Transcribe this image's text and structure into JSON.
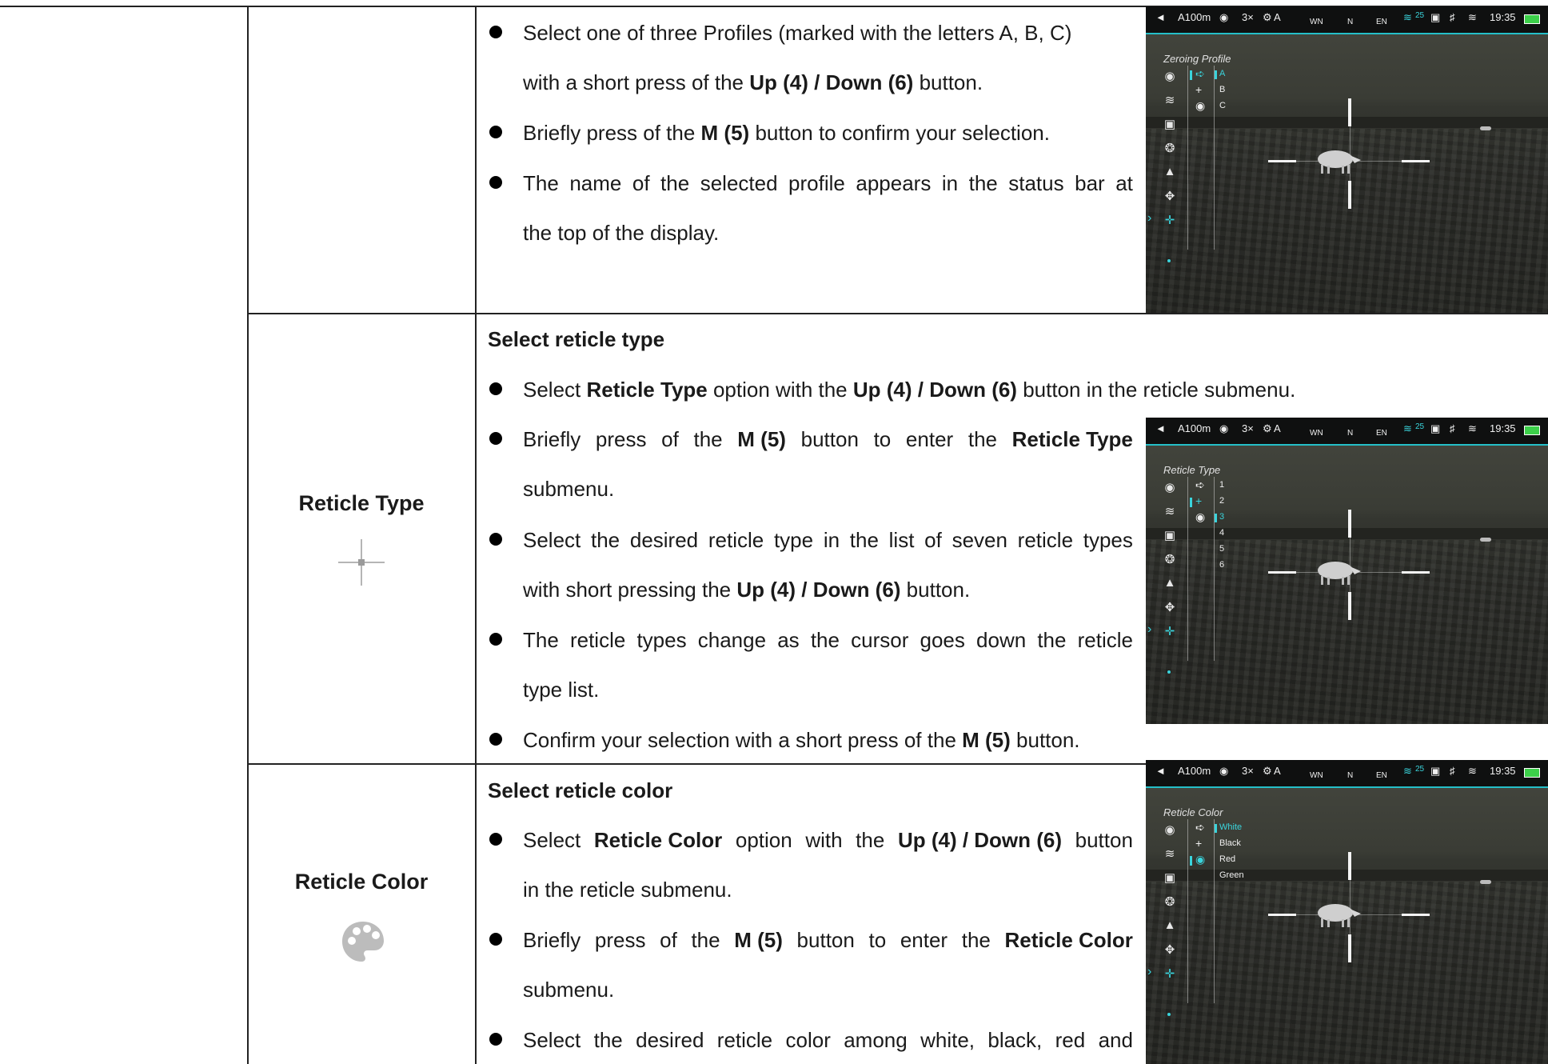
{
  "rows": {
    "zeroing": {
      "bullets": [
        {
          "line1": [
            "Select one of three Profiles (marked with the letters A, B, C)"
          ],
          "line2": "with a short press of the ",
          "line2_b": "Up (4) / Down (6)",
          "line2_end": " button."
        },
        {
          "pre": "Briefly press of the ",
          "b": "M (5)",
          "post": " button to confirm your selection."
        },
        {
          "line1_words": [
            "The",
            "name",
            "of",
            "the",
            "selected",
            "profile",
            "appears",
            "in",
            "the",
            "status",
            "bar",
            "at"
          ],
          "line2": "the top of the display."
        }
      ]
    },
    "reticle_type": {
      "label": "Reticle Type",
      "heading": "Select reticle type",
      "b1": {
        "a": "Select ",
        "b": "Reticle Type",
        "c": " option with the ",
        "d": "Up (4) / Down (6)",
        "e": " button in the reticle submenu."
      },
      "b2": {
        "w1": "Briefly",
        "w2": "press",
        "w3": "of",
        "w4": "the",
        "w5": "M (5)",
        "w6": "button",
        "w7": "to",
        "w8": "enter",
        "w9": "the",
        "w10": "Reticle Type",
        "line2": "submenu."
      },
      "b3": {
        "line1_words": [
          "Select",
          "the",
          "desired",
          "reticle",
          "type",
          "in",
          "the",
          "list",
          "of",
          "seven",
          "reticle",
          "types"
        ],
        "l2a": "with short pressing the ",
        "l2b": "Up (4) / Down (6)",
        "l2c": " button."
      },
      "b4": {
        "line1_words": [
          "The",
          "reticle",
          "types",
          "change",
          "as",
          "the",
          "cursor",
          "goes",
          "down",
          "the",
          "reticle"
        ],
        "line2": "type list."
      },
      "b5": {
        "a": "Confirm your selection with a short press of the ",
        "b": "M (5)",
        "c": " button."
      }
    },
    "reticle_color": {
      "label": "Reticle Color",
      "heading": "Select reticle color",
      "b1": {
        "w1": "Select",
        "w2": "Reticle Color",
        "w3": "option",
        "w4": "with",
        "w5": "the",
        "w6": "Up (4) / Down (6)",
        "w7": "button",
        "line2": "in the reticle submenu."
      },
      "b2": {
        "w1": "Briefly",
        "w2": "press",
        "w3": "of",
        "w4": "the",
        "w5": "M (5)",
        "w6": "button",
        "w7": "to",
        "w8": "enter",
        "w9": "the",
        "w10": "Reticle Color",
        "line2": "submenu."
      },
      "b3": {
        "line1_words": [
          "Select",
          "the",
          "desired",
          "reticle",
          "color",
          "among",
          "white,",
          "black,",
          "red",
          "and"
        ]
      }
    }
  },
  "device": {
    "status": {
      "dist": "A100m",
      "zoom": "3×",
      "profile": "A",
      "time": "19:35",
      "compass": [
        "WN",
        "N",
        "EN"
      ],
      "num": "25"
    },
    "screens": [
      {
        "title": "Zeroing Profile",
        "options": [
          "A",
          "B",
          "C"
        ],
        "selected": 0
      },
      {
        "title": "Reticle Type",
        "options": [
          "1",
          "2",
          "3",
          "4",
          "5",
          "6"
        ],
        "selected": 2
      },
      {
        "title": "Reticle Color",
        "options": [
          "White",
          "Black",
          "Red",
          "Green"
        ],
        "selected": 0
      }
    ]
  },
  "icons": {
    "reticle": "crosshair-icon",
    "palette": "palette-icon",
    "accent": "#3ad4dc"
  }
}
